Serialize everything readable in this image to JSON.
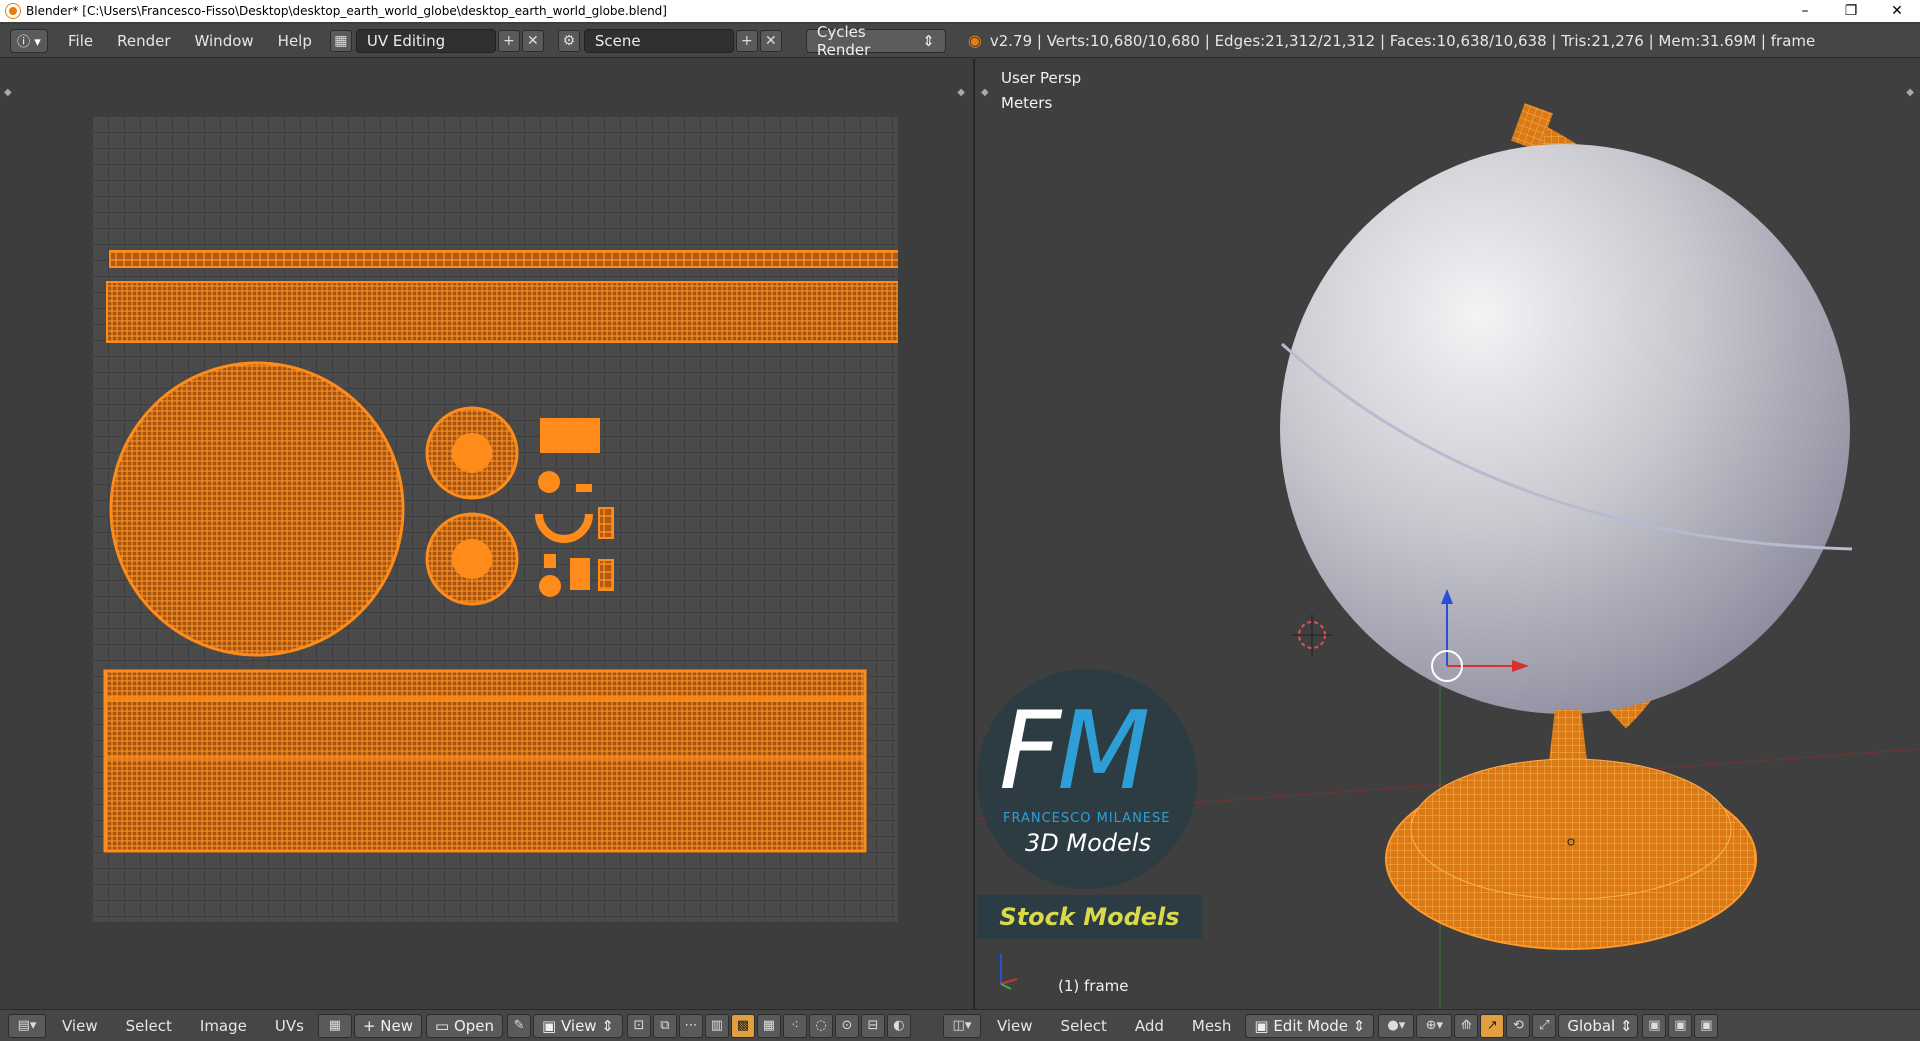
{
  "window": {
    "title": "Blender* [C:\\Users\\Francesco-Fisso\\Desktop\\desktop_earth_world_globe\\desktop_earth_world_globe.blend]",
    "minimize": "–",
    "restore": "❐",
    "close": "✕"
  },
  "topbar": {
    "info_icon": "info-icon",
    "menus": [
      "File",
      "Render",
      "Window",
      "Help"
    ],
    "screen_layout": "UV Editing",
    "scene": "Scene",
    "render_engine": "Cycles Render",
    "stats": "v2.79 | Verts:10,680/10,680 | Edges:21,312/21,312 | Faces:10,638/10,638 | Tris:21,276 | Mem:31.69M | frame"
  },
  "viewport": {
    "perspective": "User Persp",
    "units": "Meters",
    "frame_label": "(1) frame"
  },
  "watermark": {
    "letters_f": "F",
    "letters_m": "M",
    "name": "FRANCESCO MILANESE",
    "subtitle": "3D Models",
    "badge": "Stock Models"
  },
  "uv_bottombar": {
    "menus": [
      "View",
      "Select",
      "Image",
      "UVs"
    ],
    "new_label": "New",
    "open_label": "Open",
    "view_label": "View"
  },
  "view3d_bottombar": {
    "menus": [
      "View",
      "Select",
      "Add",
      "Mesh"
    ],
    "mode": "Edit Mode",
    "orientation": "Global"
  },
  "colors": {
    "accent": "#ff8c1a",
    "ui_bg": "#464646",
    "panel_bg": "#3d3d3d"
  }
}
